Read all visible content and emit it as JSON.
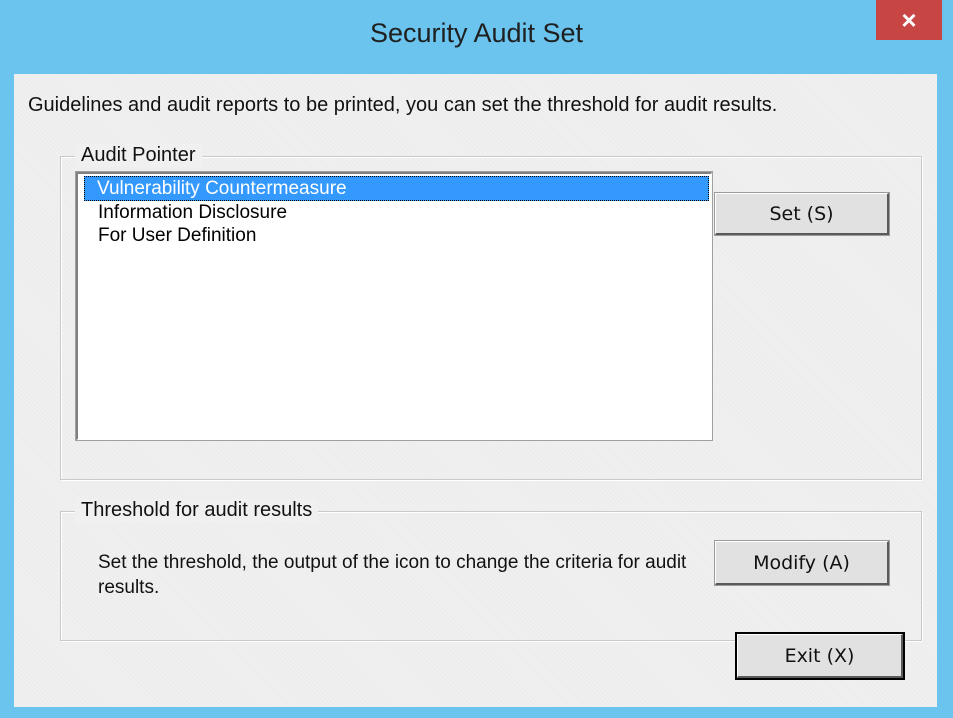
{
  "window": {
    "title": "Security Audit Set",
    "close_label": "×"
  },
  "intro_text": "Guidelines and audit reports to be printed, you can set the threshold for audit results.",
  "audit_pointer": {
    "legend": "Audit Pointer",
    "items": [
      {
        "label": "Vulnerability Countermeasure",
        "selected": true
      },
      {
        "label": "Information Disclosure",
        "selected": false
      },
      {
        "label": "For User Definition",
        "selected": false
      }
    ],
    "set_button": "Set (S)"
  },
  "threshold": {
    "legend": "Threshold for audit results",
    "description": "Set the threshold, the output of the icon to change the criteria for audit results.",
    "modify_button": "Modify (A)"
  },
  "exit_button": "Exit (X)",
  "colors": {
    "titlebar": "#6ac4ee",
    "close": "#c74543",
    "selection": "#3399ff",
    "client": "#f0f0f0"
  }
}
